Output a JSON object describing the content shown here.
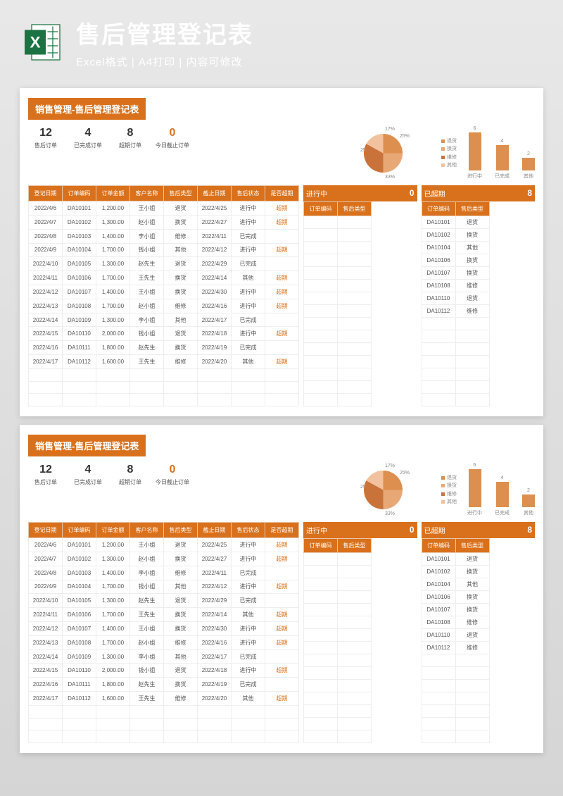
{
  "header": {
    "title": "售后管理登记表",
    "subtitle": "Excel格式 | A4打印 | 内容可修改"
  },
  "sheet": {
    "title": "销售管理-售后管理登记表",
    "stats": [
      {
        "num": "12",
        "label": "售后订单"
      },
      {
        "num": "4",
        "label": "已完成订单"
      },
      {
        "num": "8",
        "label": "超期订单"
      },
      {
        "num": "0",
        "label": "今日截止订单",
        "red": true
      }
    ]
  },
  "chart_data": [
    {
      "type": "pie",
      "title": "",
      "series": [
        {
          "name": "退货",
          "value": 25,
          "color": "#dc8f4f"
        },
        {
          "name": "换货",
          "value": 25,
          "color": "#e8a876"
        },
        {
          "name": "维修",
          "value": 33,
          "color": "#c9733b"
        },
        {
          "name": "其他",
          "value": 17,
          "color": "#f2c29e"
        }
      ]
    },
    {
      "type": "bar",
      "categories": [
        "进行中",
        "已完成",
        "其他"
      ],
      "values": [
        6,
        4,
        2
      ],
      "ylim": [
        0,
        6
      ]
    }
  ],
  "main_table": {
    "headers": [
      "登记日期",
      "订单编码",
      "订单金额",
      "客户名称",
      "售后类型",
      "截止日期",
      "售后状态",
      "是否超期"
    ],
    "rows": [
      [
        "2022/4/6",
        "DA10101",
        "1,200.00",
        "王小姐",
        "退货",
        "2022/4/25",
        "进行中",
        "超期"
      ],
      [
        "2022/4/7",
        "DA10102",
        "1,300.00",
        "赵小姐",
        "换货",
        "2022/4/27",
        "进行中",
        "超期"
      ],
      [
        "2022/4/8",
        "DA10103",
        "1,400.00",
        "李小姐",
        "维修",
        "2022/4/11",
        "已完成",
        ""
      ],
      [
        "2022/4/9",
        "DA10104",
        "1,700.00",
        "钱小姐",
        "其他",
        "2022/4/12",
        "进行中",
        "超期"
      ],
      [
        "2022/4/10",
        "DA10105",
        "1,300.00",
        "赵先生",
        "退货",
        "2022/4/29",
        "已完成",
        ""
      ],
      [
        "2022/4/11",
        "DA10106",
        "1,700.00",
        "王先生",
        "换货",
        "2022/4/14",
        "其他",
        "超期"
      ],
      [
        "2022/4/12",
        "DA10107",
        "1,400.00",
        "王小姐",
        "换货",
        "2022/4/30",
        "进行中",
        "超期"
      ],
      [
        "2022/4/13",
        "DA10108",
        "1,700.00",
        "赵小姐",
        "维修",
        "2022/4/16",
        "进行中",
        "超期"
      ],
      [
        "2022/4/14",
        "DA10109",
        "1,300.00",
        "李小姐",
        "其他",
        "2022/4/17",
        "已完成",
        ""
      ],
      [
        "2022/4/15",
        "DA10110",
        "2,000.00",
        "钱小姐",
        "退货",
        "2022/4/18",
        "进行中",
        "超期"
      ],
      [
        "2022/4/16",
        "DA10111",
        "1,800.00",
        "赵先生",
        "换货",
        "2022/4/19",
        "已完成",
        ""
      ],
      [
        "2022/4/17",
        "DA10112",
        "1,600.00",
        "王先生",
        "维修",
        "2022/4/20",
        "其他",
        "超期"
      ]
    ]
  },
  "side1": {
    "head_label": "进行中",
    "head_num": "0",
    "headers": [
      "订单编码",
      "售后类型"
    ],
    "rows": [
      [
        "",
        ""
      ],
      [
        "",
        ""
      ],
      [
        "",
        ""
      ],
      [
        "",
        ""
      ],
      [
        "",
        ""
      ],
      [
        "",
        ""
      ],
      [
        "",
        ""
      ],
      [
        "",
        ""
      ],
      [
        "",
        ""
      ],
      [
        "",
        ""
      ],
      [
        "",
        ""
      ],
      [
        "",
        ""
      ]
    ]
  },
  "side2": {
    "head_label": "已超期",
    "head_num": "8",
    "headers": [
      "订单编码",
      "售后类型"
    ],
    "rows": [
      [
        "DA10101",
        "退货"
      ],
      [
        "DA10102",
        "换货"
      ],
      [
        "DA10104",
        "其他"
      ],
      [
        "DA10106",
        "换货"
      ],
      [
        "DA10107",
        "换货"
      ],
      [
        "DA10108",
        "维修"
      ],
      [
        "DA10110",
        "退货"
      ],
      [
        "DA10112",
        "维修"
      ],
      [
        "",
        ""
      ],
      [
        "",
        ""
      ],
      [
        "",
        ""
      ],
      [
        "",
        ""
      ]
    ]
  }
}
